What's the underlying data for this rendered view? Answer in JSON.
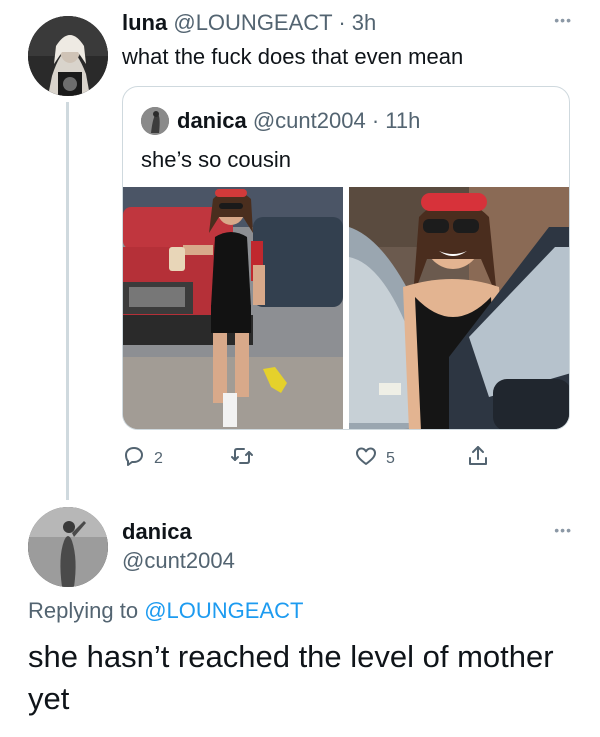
{
  "original_tweet": {
    "display_name": "luna",
    "handle": "@LOUNGEACT",
    "separator": "·",
    "time": "3h",
    "text": "what the fuck does that even mean",
    "more_icon": "more-horizontal-icon"
  },
  "quoted_tweet": {
    "display_name": "danica",
    "handle": "@cunt2004",
    "separator": "·",
    "time": "11h",
    "text": "she’s so cousin"
  },
  "actions": {
    "reply_count": "2",
    "retweet_count": "",
    "like_count": "5",
    "icons": [
      "reply-icon",
      "retweet-icon",
      "like-icon",
      "share-icon"
    ]
  },
  "reply_tweet": {
    "display_name": "danica",
    "handle": "@cunt2004",
    "replying_label": "Replying to",
    "replying_handle": "@LOUNGEACT",
    "text": "she hasn’t reached the level of mother yet"
  },
  "colors": {
    "text": "#0f1419",
    "secondary": "#536471",
    "link": "#1d9bf0",
    "border": "#cfd9de"
  }
}
